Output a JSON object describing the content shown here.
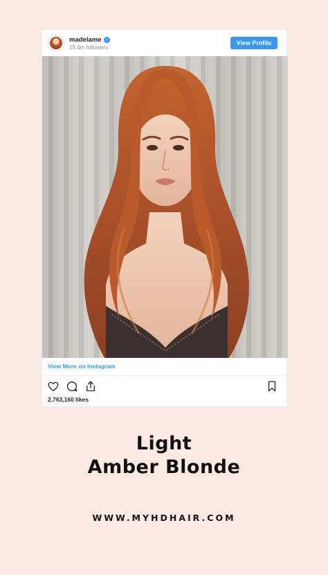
{
  "post": {
    "username": "madelame",
    "followers": "19.4m followers",
    "view_profile_label": "View Profile",
    "view_more_label": "View More on Instagram",
    "likes": "2,763,160 likes",
    "photo_alt": "Woman with long wavy light amber blonde hair in front of a grey curtain"
  },
  "icons": {
    "verified": "verified-badge-icon",
    "like": "heart-icon",
    "comment": "comment-icon",
    "share": "share-icon",
    "save": "bookmark-icon"
  },
  "colors": {
    "background": "#fbeae4",
    "accent": "#3897f0",
    "hair": "#b5552c"
  },
  "headline": {
    "line1": "Light",
    "line2": "Amber Blonde"
  },
  "website": "WWW.MYHDHAIR.COM"
}
